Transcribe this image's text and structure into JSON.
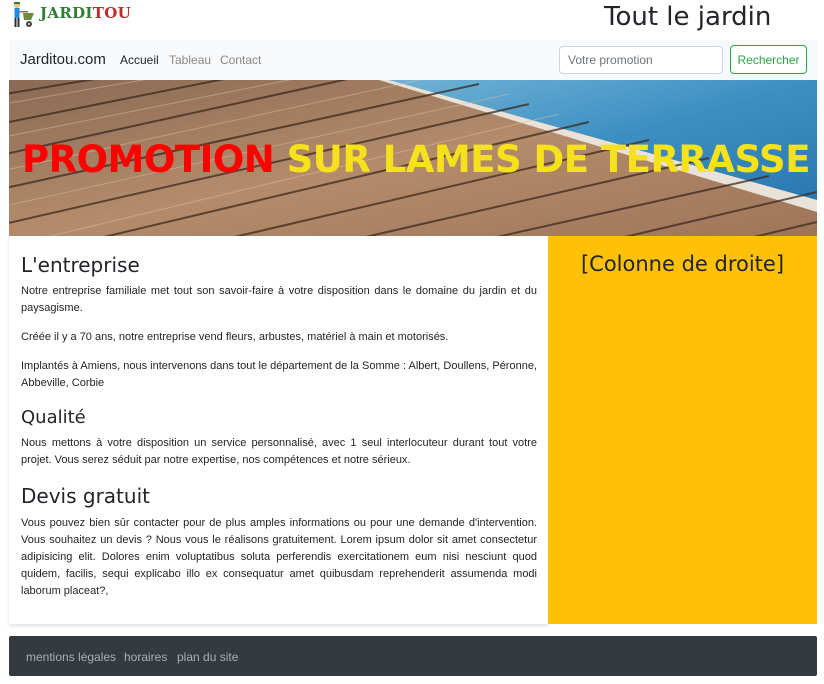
{
  "header": {
    "logo_text": "JARDITOU",
    "logo_green": "JARDI",
    "logo_red": "TOU",
    "site_title": "Tout le jardin"
  },
  "navbar": {
    "brand": "Jarditou.com",
    "links": [
      {
        "label": "Accueil",
        "active": true
      },
      {
        "label": "Tableau",
        "active": false
      },
      {
        "label": "Contact",
        "active": false
      }
    ],
    "search_placeholder": "Votre promotion",
    "search_button": "Rechercher"
  },
  "hero": {
    "text_red": "PROMOTION",
    "text_yellow": "SUR LAMES DE TERRASSE"
  },
  "main": {
    "sections": [
      {
        "title": "L'entreprise",
        "paragraphs": [
          "Notre entreprise familiale met tout son savoir-faire à votre disposition dans le domaine du jardin et du paysagisme.",
          "Créée il y a 70 ans, notre entreprise vend fleurs, arbustes, matériel à main et motorisés.",
          "Implantés à Amiens, nous intervenons dans tout le département de la Somme : Albert, Doullens, Péronne, Abbeville, Corbie"
        ]
      },
      {
        "title": "Qualité",
        "paragraphs": [
          "Nous mettons à votre disposition un service personnalisé, avec 1 seul interlocuteur durant tout votre projet. Vous serez séduit par notre expertise, nos compétences et notre sérieux."
        ]
      },
      {
        "title": "Devis gratuit",
        "paragraphs": [
          "Vous pouvez bien sûr contacter pour de plus amples informations ou pour une demande d'intervention. Vous souhaitez un devis ? Nous vous le réalisons gratuitement. Lorem ipsum dolor sit amet consectetur adipisicing elit. Dolores enim voluptatibus soluta perferendis exercitationem eum nisi nesciunt quod quidem, facilis, sequi explicabo illo ex consequatur amet quibusdam reprehenderit assumenda modi laborum placeat?,"
        ]
      }
    ]
  },
  "right_column": {
    "title": "[Colonne de droite]"
  },
  "footer": {
    "links": [
      "mentions légales",
      "horaires",
      "plan du site"
    ]
  },
  "colors": {
    "right_column_bg": "#ffc107",
    "footer_bg": "#343a40",
    "search_button": "#28a745",
    "hero_red": "#ff0000",
    "hero_yellow": "#f5e21b"
  },
  "icons": {
    "logo": "gardener-wheelbarrow-icon"
  }
}
